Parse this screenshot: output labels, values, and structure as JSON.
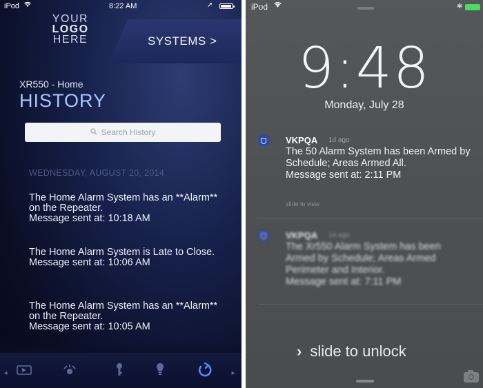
{
  "left": {
    "status": {
      "carrier": "iPod",
      "wifi_icon": "wifi-icon",
      "time": "8:22 AM",
      "location_icon": "location-arrow-icon"
    },
    "logo": {
      "line1": "YOUR",
      "line2": "LOGO",
      "line3": "HERE"
    },
    "systems_tab": "SYSTEMS >",
    "panel_name": "XR550 - Home",
    "page_title": "HISTORY",
    "search": {
      "placeholder": "Search History"
    },
    "date_header": "WEDNESDAY, AUGUST 20, 2014",
    "entries": [
      {
        "text": "The Home Alarm System has an **Alarm** on the Repeater.\nMessage sent at: 10:18 AM"
      },
      {
        "text": "The Home Alarm System is Late to Close.\nMessage sent at: 10:06 AM"
      },
      {
        "text": "The Home Alarm System has an **Alarm** on the Repeater.\nMessage sent at: 10:05 AM"
      }
    ],
    "nav": [
      "video-icon",
      "sensors-icon",
      "lock-icon",
      "lights-icon",
      "history-icon"
    ]
  },
  "right": {
    "status": {
      "carrier": "iPod",
      "battery_color": "#4cd964"
    },
    "clock": "9:48",
    "date": "Monday, July 28",
    "notifications": [
      {
        "app": "VKPQA",
        "time": "1d ago",
        "body": "The 50 Alarm System has been Armed by Schedule; Areas Armed All.\nMessage sent at:  2:11 PM",
        "hint": "slide to view"
      },
      {
        "app": "VKPQA",
        "time": "1d ago",
        "body": "The Xr550 Alarm System has been Armed by Schedule; Areas Armed Perimeter and Interior.\nMessage sent at:  7:11 PM"
      }
    ],
    "unlock": "slide to unlock"
  }
}
